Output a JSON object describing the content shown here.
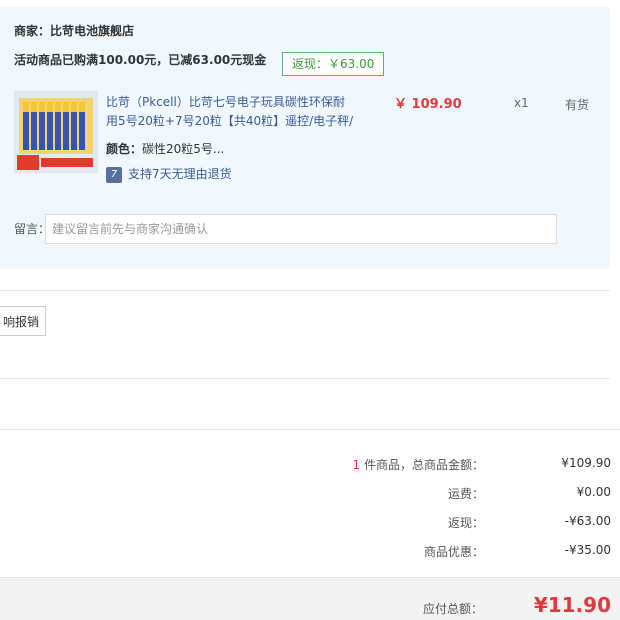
{
  "store": {
    "merchant": "商家：比苛电池旗舰店",
    "promo": "活动商品已购满100.00元，已减63.00元现金",
    "rebate_tag": "返现：￥63.00",
    "product": {
      "name": "比苛（Pkcell）比苛七号电子玩具碳性环保耐用5号20粒+7号20粒【共40粒】遥控/电子秤/",
      "price": "￥ 109.90",
      "quantity": "x1",
      "stock": "有货",
      "color_label": "颜色：",
      "color_value": "碳性20粒5号...",
      "return_badge": "7",
      "return_policy": "支持7天无理由退货"
    },
    "note": {
      "label": "留言：",
      "placeholder": "建议留言前先与商家沟通确认"
    }
  },
  "report_button": "响报销",
  "summary": {
    "count": "1",
    "count_label": "件商品，总商品金额：",
    "goods_total": "¥109.90",
    "shipping_label": "运费：",
    "shipping": "¥0.00",
    "rebate_label": "返现：",
    "rebate": "-¥63.00",
    "discount_label": "商品优惠：",
    "discount": "-¥35.00",
    "total_label": "应付总额：",
    "total": "¥11.90"
  },
  "colors": {
    "accent_red": "#e4393c",
    "link_blue": "#3a5a9a",
    "rebate_green": "#3c9a3c",
    "panel_bg": "#f1f8fd"
  },
  "icons": [
    "product-thumbnail-image",
    "seven-day-return-icon"
  ]
}
